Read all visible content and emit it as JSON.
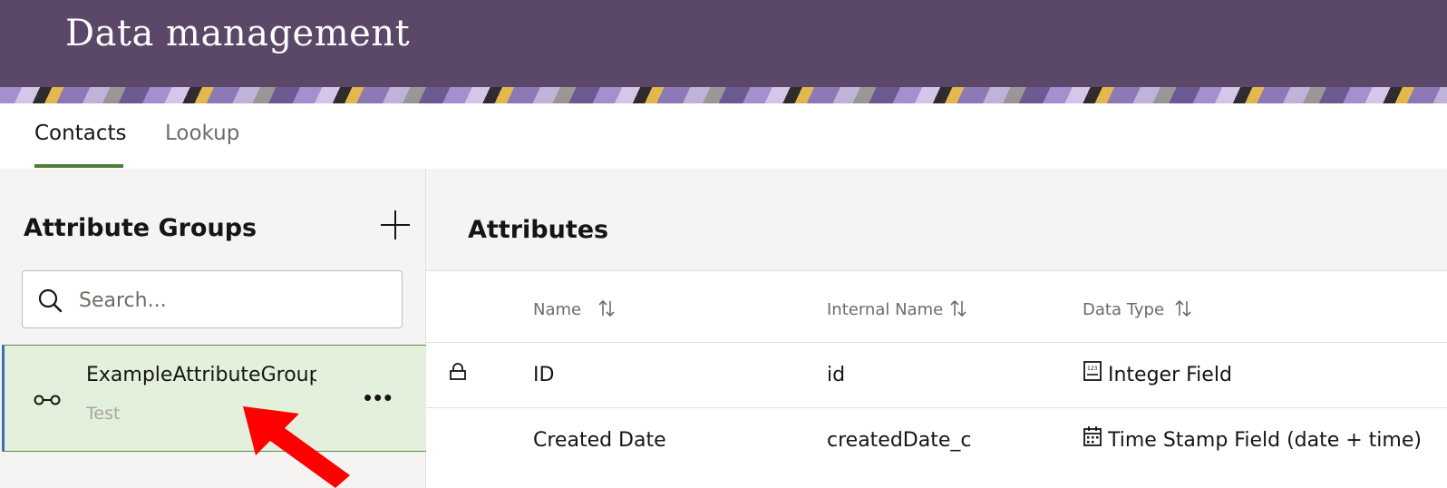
{
  "header": {
    "title": "Data management"
  },
  "tabs": [
    {
      "label": "Contacts",
      "active": true
    },
    {
      "label": "Lookup",
      "active": false
    }
  ],
  "left_panel": {
    "title": "Attribute Groups",
    "search": {
      "placeholder": "Search...",
      "value": ""
    },
    "groups": [
      {
        "name": "ExampleAttributeGroup",
        "description": "Test",
        "selected": true
      }
    ]
  },
  "right_panel": {
    "title": "Attributes",
    "columns": [
      "Name",
      "Internal Name",
      "Data Type"
    ],
    "rows": [
      {
        "locked": true,
        "name": "ID",
        "internal_name": "id",
        "data_type": "Integer Field",
        "type_icon": "integer-icon"
      },
      {
        "locked": false,
        "name": "Created Date",
        "internal_name": "createdDate_c",
        "data_type": "Time Stamp Field (date + time)",
        "type_icon": "calendar-icon"
      }
    ]
  },
  "colors": {
    "header_bg": "#5b4768",
    "tab_underline": "#4e7d35",
    "selected_bg": "#e3f1dc",
    "selected_left_border": "#3a70b8",
    "annotation_arrow": "#ff0000"
  }
}
